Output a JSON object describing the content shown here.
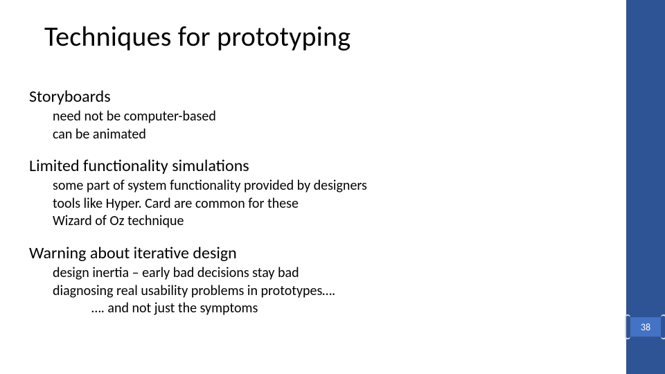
{
  "title": "Techniques for prototyping",
  "sections": [
    {
      "heading": "Storyboards",
      "items": [
        {
          "text": "need not be computer-based",
          "level": 1
        },
        {
          "text": "can be animated",
          "level": 1
        }
      ]
    },
    {
      "heading": "Limited functionality simulations",
      "items": [
        {
          "text": "some part of system functionality provided by designers",
          "level": 1
        },
        {
          "text": "tools like Hyper. Card are common for these",
          "level": 1
        },
        {
          "text": "Wizard of Oz technique",
          "level": 1
        }
      ]
    },
    {
      "heading": "Warning about iterative design",
      "items": [
        {
          "text": "design inertia – early bad decisions stay bad",
          "level": 1
        },
        {
          "text": "diagnosing real usability problems in prototypes….",
          "level": 1
        },
        {
          "text": "…. and not just the symptoms",
          "level": 2
        }
      ]
    }
  ],
  "page_number": "38",
  "colors": {
    "accent": "#2f5496",
    "badge": "#4472c4"
  }
}
